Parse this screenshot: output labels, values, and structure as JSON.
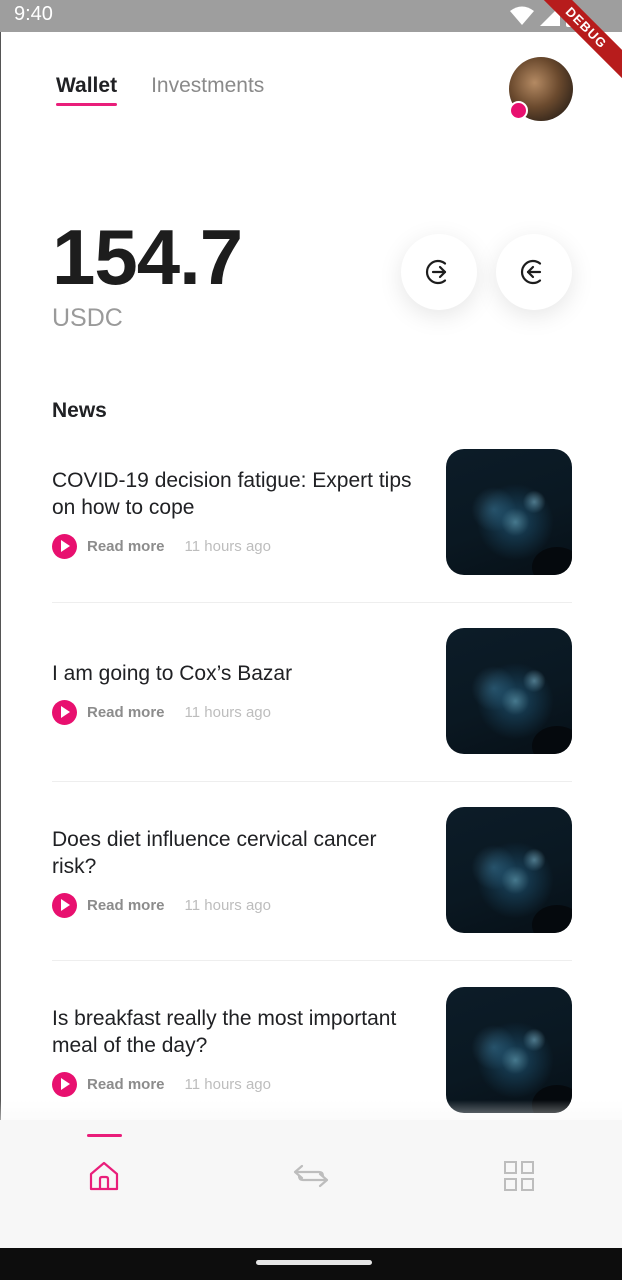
{
  "status_bar": {
    "time": "9:40",
    "icons": [
      "wifi-icon",
      "cellular-icon",
      "battery-icon"
    ],
    "debug_label": "DEBUG"
  },
  "header": {
    "tabs": [
      {
        "label": "Wallet",
        "active": true
      },
      {
        "label": "Investments",
        "active": false
      }
    ],
    "avatar_status_color": "#e8106f"
  },
  "balance": {
    "amount": "154.7",
    "currency": "USDC"
  },
  "actions": {
    "send_icon": "arrow-right-circle-icon",
    "receive_icon": "arrow-left-circle-icon"
  },
  "news": {
    "title": "News",
    "items": [
      {
        "headline": "COVID-19 decision fatigue: Expert tips on how to cope",
        "read_more": "Read more",
        "time": "11 hours ago"
      },
      {
        "headline": "I am going to Cox’s Bazar",
        "read_more": "Read more",
        "time": "11 hours ago"
      },
      {
        "headline": "Does diet influence cervical cancer risk?",
        "read_more": "Read more",
        "time": "11 hours ago"
      },
      {
        "headline": "Is breakfast really the most important meal of the day?",
        "read_more": "Read more",
        "time": "11 hours ago"
      }
    ]
  },
  "bottom_nav": {
    "items": [
      {
        "icon": "home-icon",
        "active": true
      },
      {
        "icon": "transfer-icon",
        "active": false
      },
      {
        "icon": "grid-icon",
        "active": false
      }
    ]
  },
  "colors": {
    "accent": "#e91e7a",
    "status_bar": "#9e9e9e",
    "text_primary": "#202124",
    "text_muted": "#8c8c8c"
  }
}
